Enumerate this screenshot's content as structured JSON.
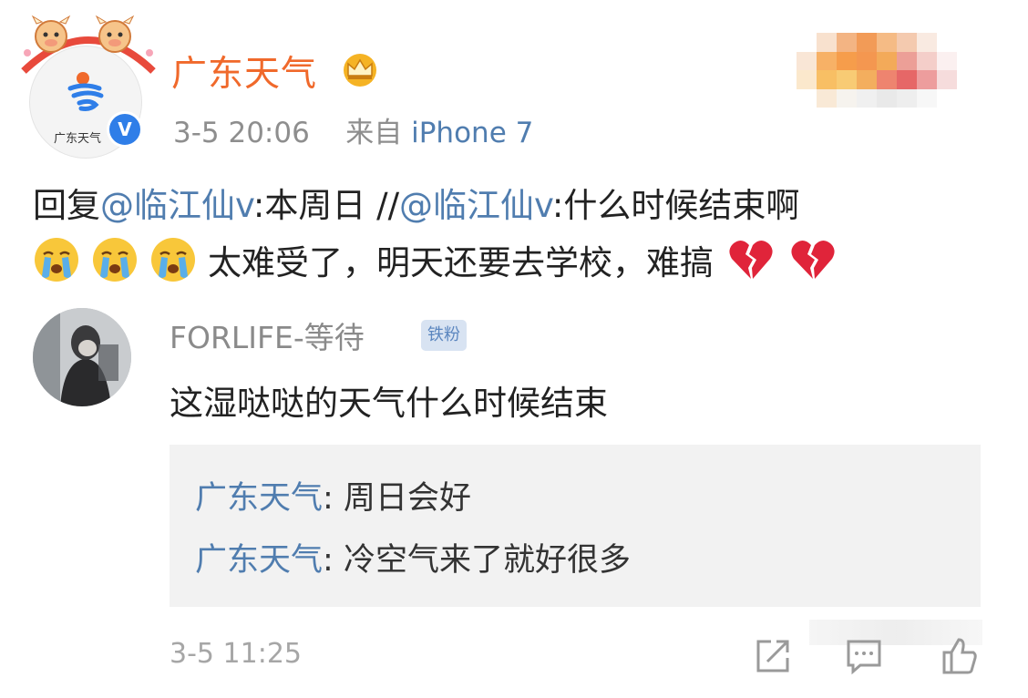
{
  "post": {
    "account_name": "广东天气",
    "avatar_text": "广东天气",
    "verified_mark": "V",
    "time": "3-5 20:06",
    "source_prefix": "来自",
    "device": "iPhone 7",
    "reply_prefix": "回复",
    "mention1": "@临江仙v",
    "text1": ":本周日",
    "separator": "//",
    "mention2": "@临江仙v",
    "text2": ":什么时候结束啊",
    "text3": "太难受了，明天还要去学校，难搞"
  },
  "comment": {
    "username": "FORLIFE-等待",
    "badge": "铁粉",
    "text": "这湿哒哒的天气什么时候结束",
    "time": "3-5 11:25",
    "replies": [
      {
        "author": "广东天气",
        "sep": ": ",
        "text": "周日会好"
      },
      {
        "author": "广东天气",
        "sep": ": ",
        "text": "冷空气来了就好很多"
      }
    ]
  },
  "icons": [
    "cow-mascot-icon",
    "weather-logo-icon",
    "verified-icon",
    "crown-icon",
    "crying-emoji-icon",
    "broken-heart-icon",
    "share-icon",
    "comment-icon",
    "like-icon"
  ],
  "colors": {
    "account_orange": "#f0692b",
    "link_blue": "#507daf",
    "meta_gray": "#8e8e8e",
    "reply_bg": "#f2f2f2",
    "verified_blue": "#2f7ee8"
  }
}
